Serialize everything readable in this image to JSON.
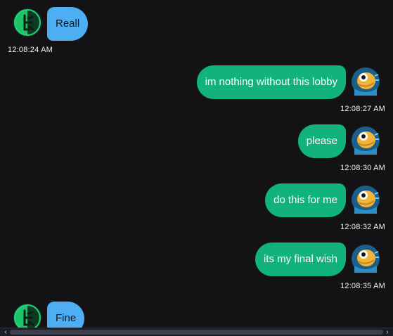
{
  "messages": [
    {
      "side": "in",
      "avatar": "frog-avatar-icon",
      "text": "Reall",
      "time": "12:08:24 AM"
    },
    {
      "side": "out",
      "avatar": "pufferfish-avatar-icon",
      "text": "im nothing without this lobby",
      "time": "12:08:27 AM"
    },
    {
      "side": "out",
      "avatar": "pufferfish-avatar-icon",
      "text": "please",
      "time": "12:08:30 AM"
    },
    {
      "side": "out",
      "avatar": "pufferfish-avatar-icon",
      "text": "do this for me",
      "time": "12:08:32 AM"
    },
    {
      "side": "out",
      "avatar": "pufferfish-avatar-icon",
      "text": "its my final wish",
      "time": "12:08:35 AM"
    },
    {
      "side": "in",
      "avatar": "frog-avatar-icon",
      "text": "Fine",
      "time": ""
    }
  ],
  "scrollbar": {
    "left_arrow": "‹",
    "right_arrow": "›"
  },
  "colors": {
    "incoming": "#4eaef4",
    "outgoing": "#11b27e",
    "background": "#131315"
  }
}
